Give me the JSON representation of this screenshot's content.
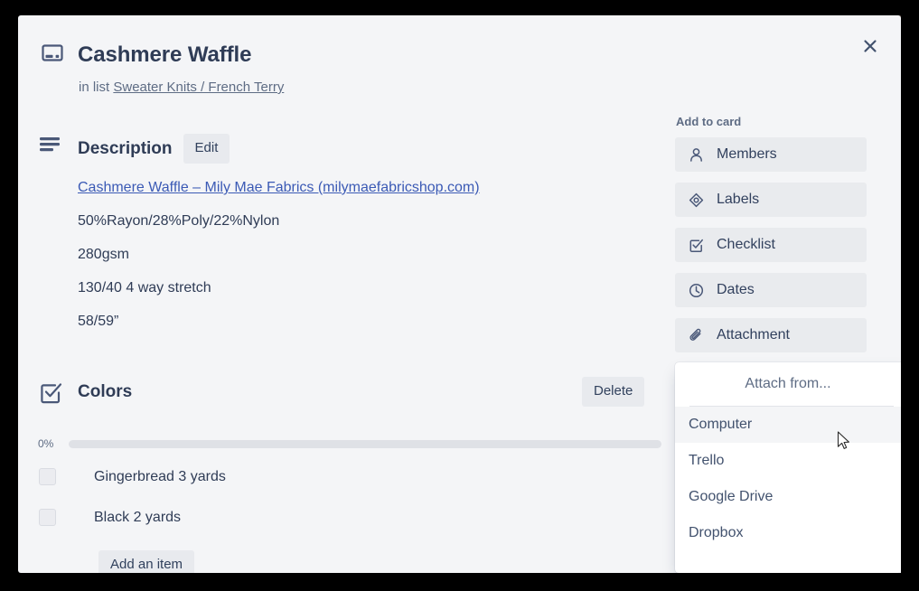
{
  "card": {
    "icon": "card-icon",
    "title": "Cashmere Waffle",
    "in_list_prefix": "in list",
    "list_name": "Sweater Knits / French Terry",
    "close_icon": "close-icon"
  },
  "description": {
    "icon": "description-icon",
    "heading": "Description",
    "edit_label": "Edit",
    "lines": [
      "Cashmere Waffle – Mily Mae Fabrics (milymaefabricshop.com)",
      "50%Rayon/28%Poly/22%Nylon",
      "280gsm",
      "130/40 4 way stretch",
      "58/59”"
    ]
  },
  "checklist": {
    "icon": "checklist-icon",
    "title": "Colors",
    "delete_label": "Delete",
    "percent": "0%",
    "progress_value": 0,
    "items": [
      {
        "label": "Gingerbread 3 yards",
        "checked": false
      },
      {
        "label": "Black 2 yards",
        "checked": false
      }
    ],
    "add_item_label": "Add an item"
  },
  "sidebar": {
    "heading": "Add to card",
    "items": [
      {
        "label": "Members",
        "icon": "person-icon"
      },
      {
        "label": "Labels",
        "icon": "label-tag-icon"
      },
      {
        "label": "Checklist",
        "icon": "checkbox-check-icon"
      },
      {
        "label": "Dates",
        "icon": "clock-icon"
      },
      {
        "label": "Attachment",
        "icon": "paperclip-icon"
      }
    ]
  },
  "attach_popup": {
    "title": "Attach from...",
    "items": [
      {
        "label": "Computer",
        "hovered": true
      },
      {
        "label": "Trello",
        "hovered": false
      },
      {
        "label": "Google Drive",
        "hovered": false
      },
      {
        "label": "Dropbox",
        "hovered": false
      }
    ]
  },
  "colors": {
    "modal_bg": "#f4f5f7",
    "text_primary": "#2f3c56",
    "text_muted": "#5e6c84",
    "button_bg": "#e9ebee",
    "link": "#3b5ab5",
    "popup_bg": "#ffffff"
  }
}
